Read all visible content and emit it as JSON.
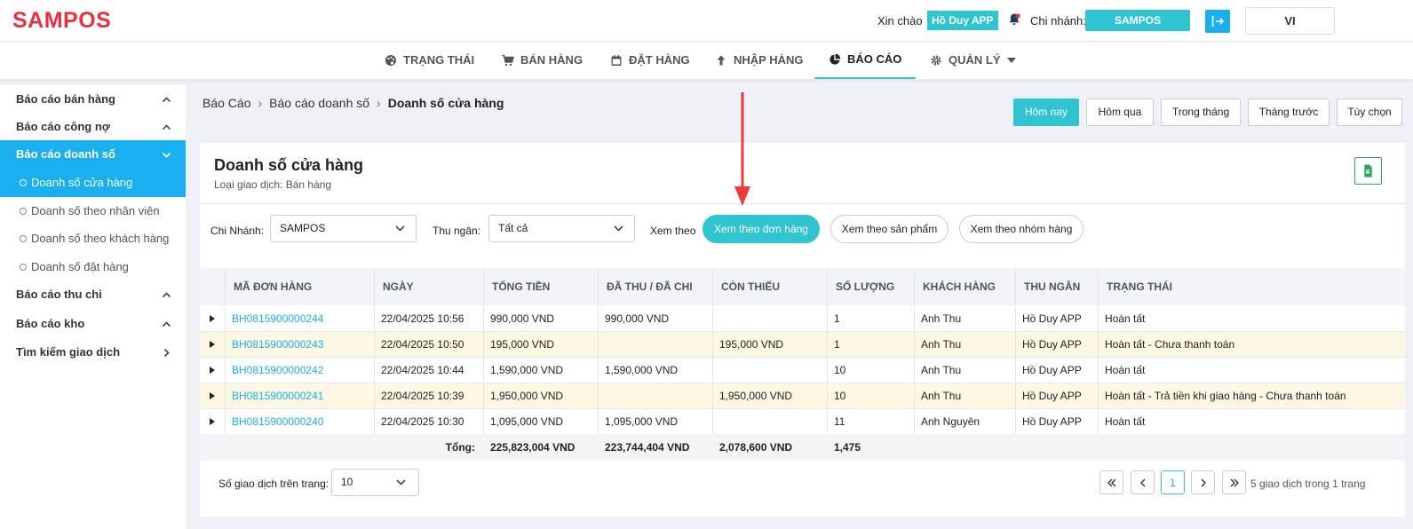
{
  "header": {
    "logo": "SAMPOS",
    "greeting": "Xin chào",
    "user_name": "Hồ Duy APP",
    "branch_label": "Chi nhánh:",
    "branch_name": "SAMPOS",
    "language": "VI",
    "accent_color": "#2fc4cf",
    "logo_color": "#e8303f"
  },
  "nav": {
    "items": [
      {
        "label": "TRẠNG THÁI",
        "icon": "palette-icon"
      },
      {
        "label": "BÁN HÀNG",
        "icon": "cart-icon"
      },
      {
        "label": "ĐẶT HÀNG",
        "icon": "calendar-icon"
      },
      {
        "label": "NHẬP HÀNG",
        "icon": "arrow-up-icon"
      },
      {
        "label": "BÁO CÁO",
        "icon": "pie-chart-icon",
        "active": true
      },
      {
        "label": "QUẢN LÝ",
        "icon": "gear-icon"
      }
    ]
  },
  "sidebar": {
    "groups": [
      {
        "label": "Báo cáo bán hàng"
      },
      {
        "label": "Báo cáo công nợ"
      },
      {
        "label": "Báo cáo doanh số",
        "active": true
      },
      {
        "label": "Báo cáo thu chi"
      },
      {
        "label": "Báo cáo kho"
      },
      {
        "label": "Tìm kiếm giao dịch"
      }
    ],
    "subitems": [
      {
        "label": "Doanh số cửa hàng",
        "active": true
      },
      {
        "label": "Doanh số theo nhân viên"
      },
      {
        "label": "Doanh số theo khách hàng"
      },
      {
        "label": "Doanh số đặt hàng"
      }
    ]
  },
  "breadcrumb": [
    "Báo Cáo",
    "Báo cáo doanh số",
    "Doanh số cửa hàng"
  ],
  "date_filters": [
    "Hôm nay",
    "Hôm qua",
    "Trong tháng",
    "Tháng trước",
    "Tùy chọn"
  ],
  "card": {
    "title": "Doanh số cửa hàng",
    "subtitle": "Loại giao dịch: Bán hàng"
  },
  "filters": {
    "branch_label": "Chi Nhánh:",
    "branch_value": "SAMPOS",
    "cashier_label": "Thu ngân:",
    "cashier_value": "Tất cả",
    "view_label": "Xem theo",
    "view_options": [
      "Xem theo đơn hàng",
      "Xem theo sản phẩm",
      "Xem theo nhóm hàng"
    ]
  },
  "table": {
    "columns": [
      "MÃ ĐƠN HÀNG",
      "NGÀY",
      "TỔNG TIỀN",
      "ĐÃ THU / ĐÃ CHI",
      "CÒN THIẾU",
      "SỐ LƯỢNG",
      "KHÁCH HÀNG",
      "THU NGÂN",
      "TRẠNG THÁI"
    ],
    "rows": [
      [
        "BH0815900000244",
        "22/04/2025 10:56",
        "990,000 VND",
        "990,000 VND",
        "",
        "1",
        "Anh Thu",
        "Hồ Duy APP",
        "Hoàn tất"
      ],
      [
        "BH0815900000243",
        "22/04/2025 10:50",
        "195,000 VND",
        "",
        "195,000 VND",
        "1",
        "Anh Thu",
        "Hồ Duy APP",
        "Hoàn tất - Chưa thanh toán"
      ],
      [
        "BH0815900000242",
        "22/04/2025 10:44",
        "1,590,000 VND",
        "1,590,000 VND",
        "",
        "10",
        "Anh Thu",
        "Hồ Duy APP",
        "Hoàn tất"
      ],
      [
        "BH0815900000241",
        "22/04/2025 10:39",
        "1,950,000 VND",
        "",
        "1,950,000 VND",
        "10",
        "Anh Thu",
        "Hồ Duy APP",
        "Hoàn tất - Trả tiền khi giao hàng - Chưa thanh toán"
      ],
      [
        "BH0815900000240",
        "22/04/2025 10:30",
        "1,095,000 VND",
        "1,095,000 VND",
        "",
        "11",
        "Anh Nguyên",
        "Hồ Duy APP",
        "Hoàn tất"
      ]
    ],
    "total": {
      "label": "Tổng:",
      "total_amount": "225,823,004 VND",
      "paid": "223,744,404 VND",
      "owed": "2,078,600 VND",
      "quantity": "1,475"
    },
    "highlight_color": "#fcf8e3"
  },
  "pagination": {
    "per_page_label": "Số giao dịch trên trang:",
    "per_page_value": "10",
    "current_page": "1",
    "info": "5 giao dịch trong 1 trang"
  }
}
